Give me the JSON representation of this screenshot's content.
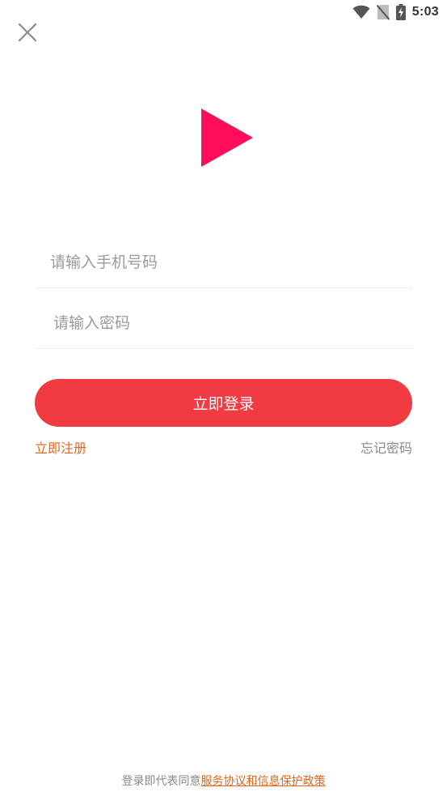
{
  "status_bar": {
    "time": "5:03",
    "icons": [
      "wifi-icon",
      "no-sim-icon",
      "battery-charging-icon"
    ]
  },
  "header": {
    "close_icon": "close-icon"
  },
  "logo": {
    "icon": "play-logo-icon",
    "color": "#ff0d5a"
  },
  "form": {
    "phone_placeholder": "请输入手机号码",
    "phone_value": "",
    "password_placeholder": "请输入密码",
    "password_value": "",
    "login_label": "立即登录",
    "register_label": "立即注册",
    "forgot_label": "忘记密码"
  },
  "footer": {
    "agreement_prefix": "登录即代表同意",
    "agreement_link": "服务协议和信息保护政策"
  },
  "colors": {
    "primary": "#f23a42",
    "link": "#e5651a",
    "muted": "#8a8a8a"
  }
}
